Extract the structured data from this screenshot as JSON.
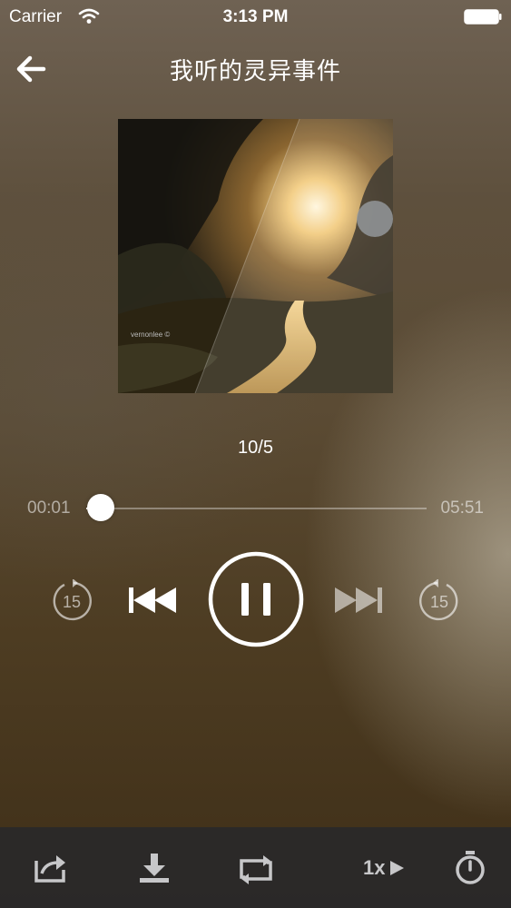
{
  "status_bar": {
    "carrier": "Carrier",
    "time": "3:13 PM"
  },
  "header": {
    "title": "我听的灵异事件",
    "back_icon": "arrow-left-icon"
  },
  "album_art": {
    "watermark": "vernonlee ©"
  },
  "player": {
    "track_index": "10/5",
    "elapsed": "00:01",
    "duration": "05:51",
    "progress_fraction": 0.003,
    "state": "playing",
    "rewind_seconds": "15",
    "forward_seconds": "15"
  },
  "toolbar": {
    "share_icon": "share-icon",
    "download_icon": "download-icon",
    "repeat_icon": "repeat-icon",
    "speed_label": "1x",
    "timer_icon": "timer-icon"
  }
}
